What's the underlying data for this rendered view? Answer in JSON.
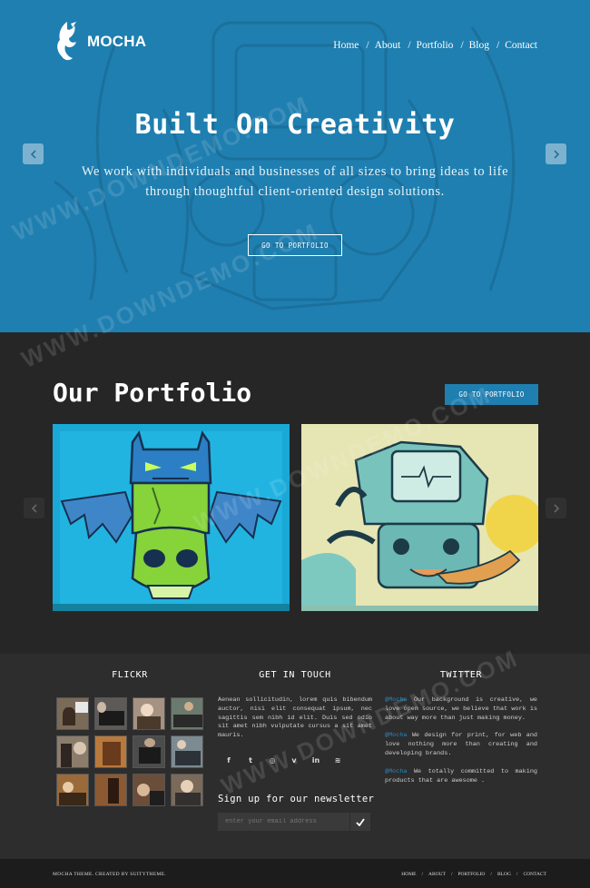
{
  "brand": {
    "name": "MOCHA"
  },
  "nav": {
    "items": [
      "Home",
      "About",
      "Portfolio",
      "Blog",
      "Contact"
    ]
  },
  "hero": {
    "title": "Built On Creativity",
    "subtitle": "We work with individuals and businesses of all sizes to bring ideas to life through thoughtful client-oriented design solutions.",
    "button": "GO TO PORTFOLIO"
  },
  "portfolio": {
    "title": "Our Portfolio",
    "button": "GO TO PORTFOLIO"
  },
  "widgets": {
    "flickr": {
      "title": "FLICKR"
    },
    "touch": {
      "title": "GET IN TOUCH",
      "text": "Aenean sollicitudin, lorem quis bibendum auctor, nisi elit consequat ipsum, nec sagittis sem nibh id elit. Duis sed odio sit amet nibh vulputate cursus a sit amet mauris.",
      "social": [
        "f",
        "t",
        "◎",
        "v",
        "in",
        "≋"
      ],
      "newsletter_title": "Sign up for our newsletter",
      "email_placeholder": "enter your email address"
    },
    "twitter": {
      "title": "TWITTER",
      "tweets": [
        {
          "handle": "@Mocha",
          "text": " Our background is creative, we love open source, we believe that work is about way more than just making money."
        },
        {
          "handle": "@Mocha",
          "text": " We design for print, for web and love nothing more than creating and developing brands."
        },
        {
          "handle": "@Mocha",
          "text": " We totally committed to making products that are awesome ."
        }
      ]
    }
  },
  "footer": {
    "copyright": "MOCHA THEME. CREATED BY SUITYTHEME.",
    "nav": [
      "HOME",
      "ABOUT",
      "PORTFOLIO",
      "BLOG",
      "CONTACT"
    ]
  },
  "watermark": {
    "text": "WWW.DOWNDEMO.COM"
  },
  "colors": {
    "accent": "#1f7fb0",
    "dark": "#262626",
    "footer": "#2d2d2d"
  }
}
